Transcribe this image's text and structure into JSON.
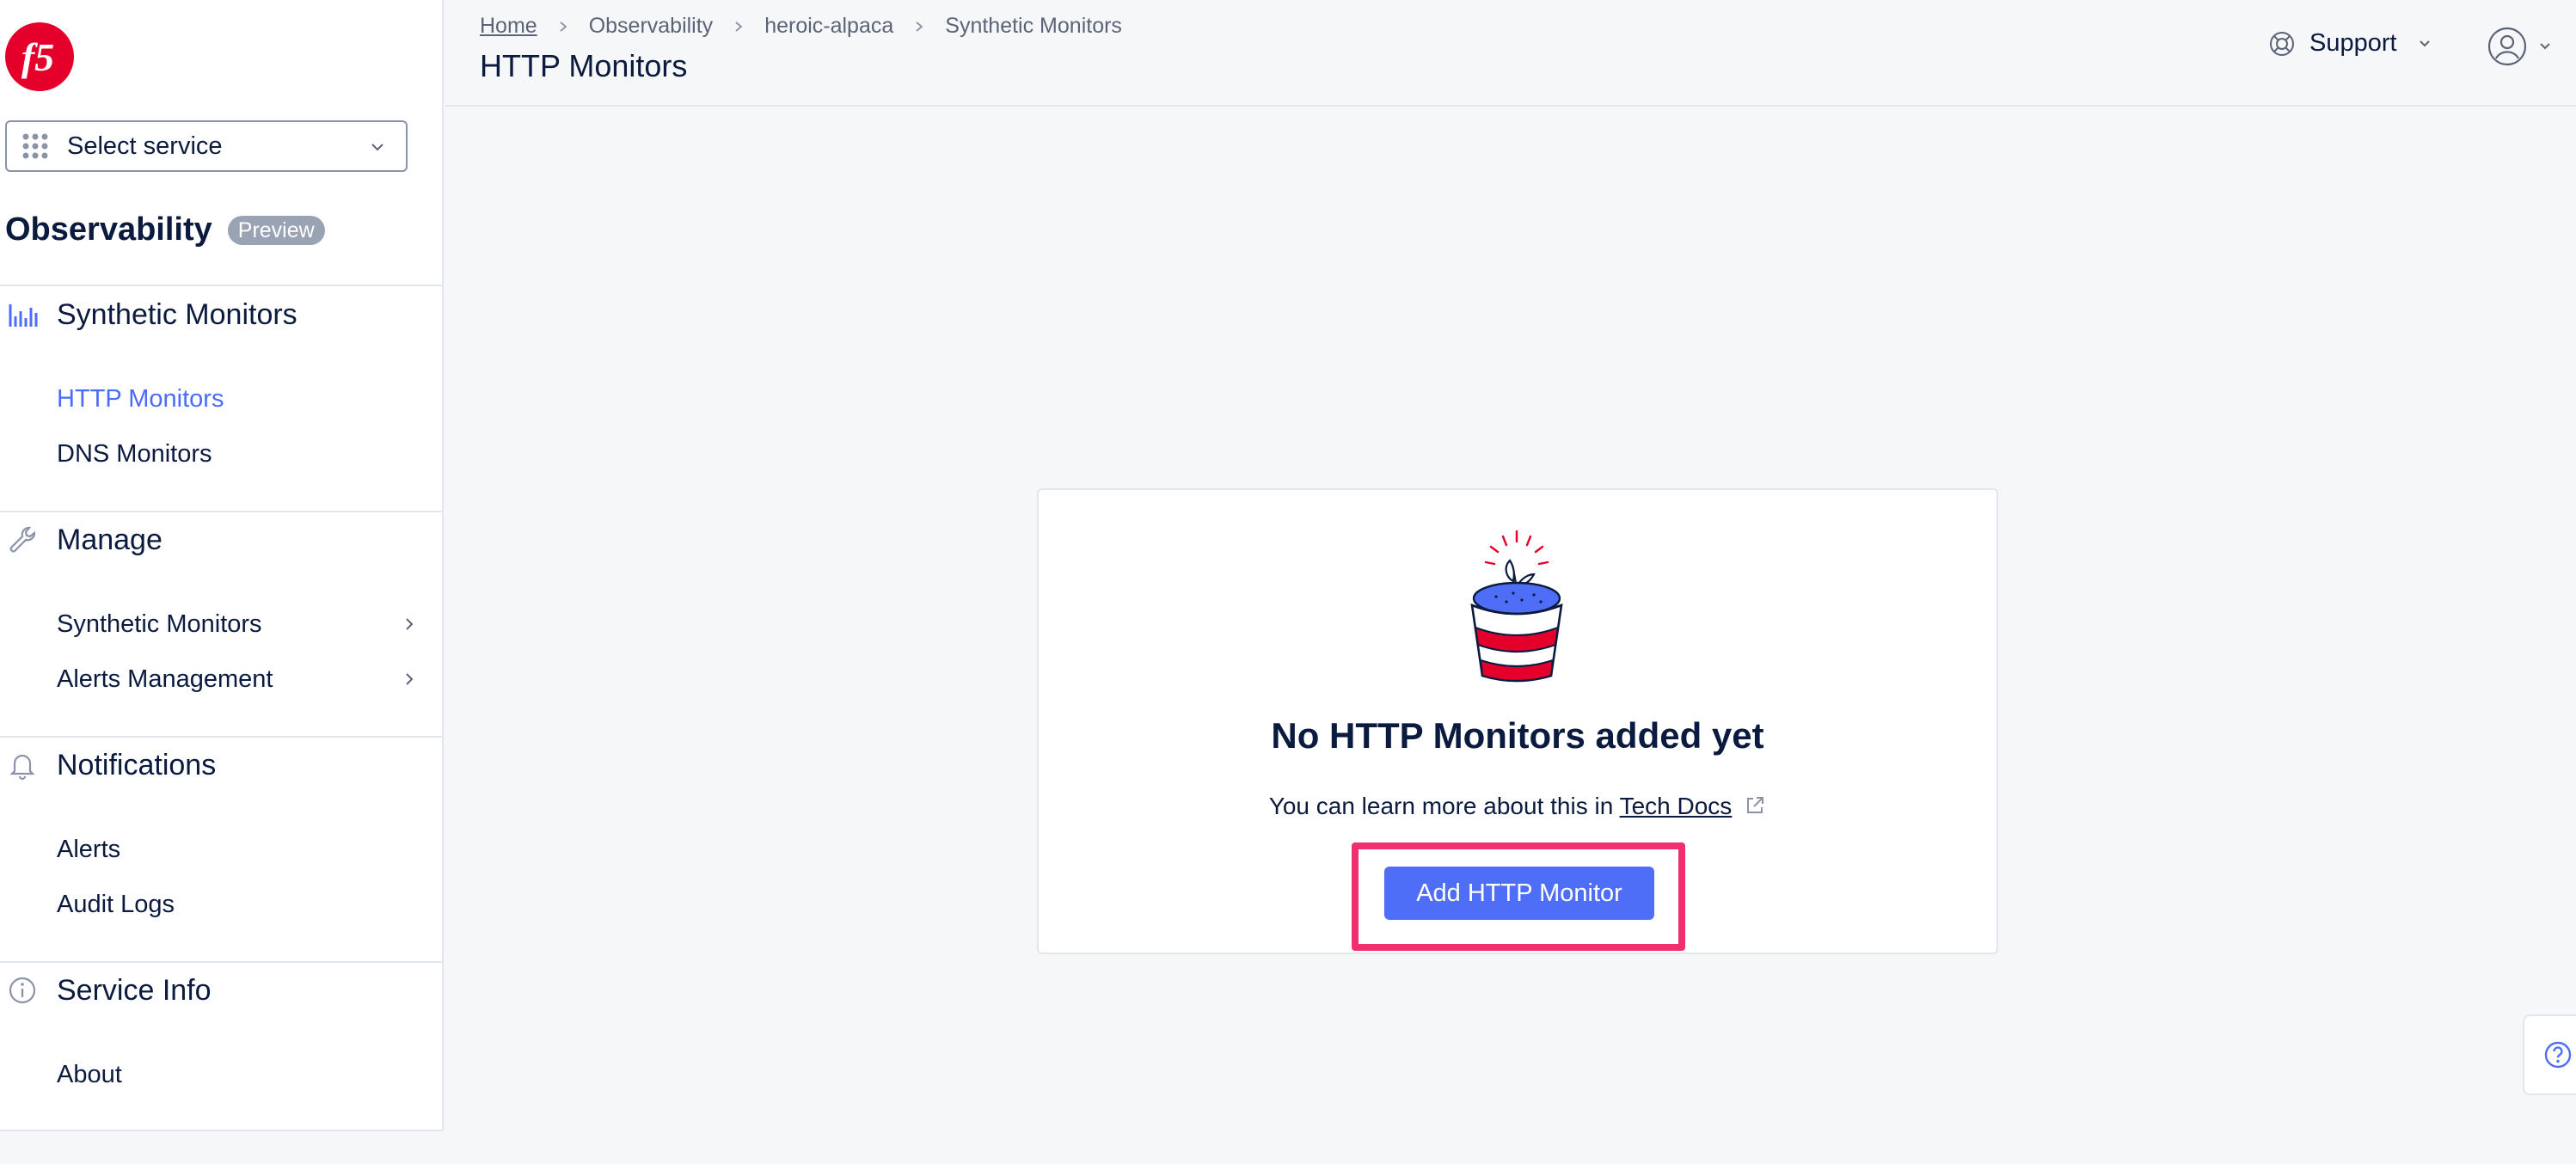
{
  "sidebar": {
    "select_service_label": "Select service",
    "app_title": "Observability",
    "app_badge": "Preview",
    "sections": [
      {
        "title": "Synthetic Monitors",
        "icon": "bar-chart-icon",
        "items": [
          "HTTP Monitors",
          "DNS Monitors"
        ]
      },
      {
        "title": "Manage",
        "icon": "wrench-icon",
        "items": [
          "Synthetic Monitors",
          "Alerts Management"
        ]
      },
      {
        "title": "Notifications",
        "icon": "bell-icon",
        "items": [
          "Alerts",
          "Audit Logs"
        ]
      },
      {
        "title": "Service Info",
        "icon": "info-icon",
        "items": [
          "About"
        ]
      }
    ],
    "active_item": "HTTP Monitors"
  },
  "header": {
    "breadcrumb": [
      "Home",
      "Observability",
      "heroic-alpaca",
      "Synthetic Monitors"
    ],
    "page_title": "HTTP Monitors",
    "support_label": "Support"
  },
  "empty_state": {
    "title": "No HTTP Monitors added yet",
    "learn_prefix": "You can learn more about this in",
    "learn_link": "Tech Docs",
    "button_label": "Add HTTP Monitor"
  },
  "colors": {
    "accent": "#4f6ef7",
    "highlight": "#f0306e",
    "brand_logo": "#e4002b",
    "text": "#0b1b3f"
  }
}
